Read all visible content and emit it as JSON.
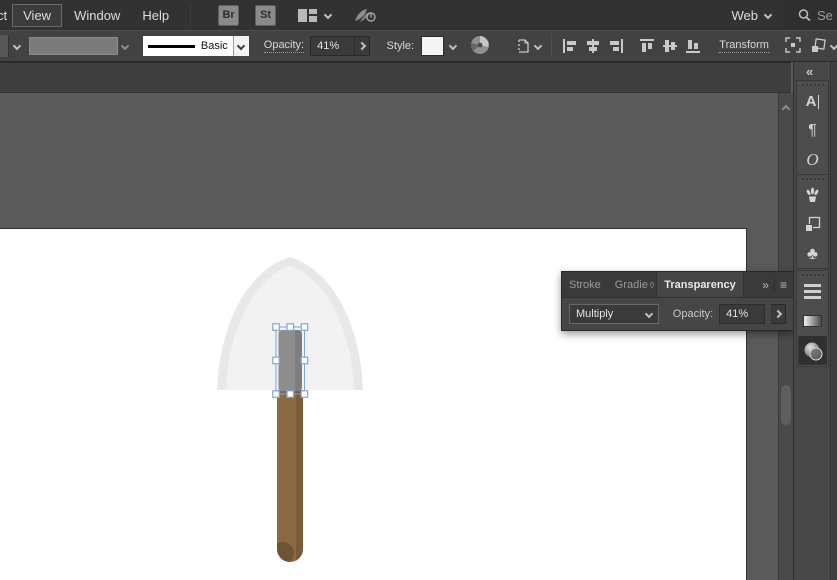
{
  "menubar": {
    "menu_clipped": "ct",
    "menus": [
      "View",
      "Window",
      "Help"
    ],
    "bridge_button": "Br",
    "stock_button": "St",
    "workspace": "Web",
    "search_text": "Se"
  },
  "controlbar": {
    "brush_definition": "Basic",
    "opacity_label": "Opacity:",
    "opacity_value": "41%",
    "style_label": "Style:",
    "transform_link": "Transform"
  },
  "transparency_panel": {
    "tabs": [
      "Stroke",
      "Gradie",
      "Transparency"
    ],
    "active_tab": "Transparency",
    "tab_clip_glyph": "◊",
    "more_glyph": "»",
    "menu_glyph": "≡",
    "blend_mode": "Multiply",
    "opacity_label": "Opacity:",
    "opacity_value": "41%"
  },
  "sidebar": {
    "collapse_glyph": "«",
    "character_glyph": "A",
    "paragraph_glyph": "¶",
    "opentype_glyph": "O",
    "symbols_glyph": "♣",
    "icon_names": [
      "character",
      "paragraph",
      "opentype",
      "brushes",
      "artboards",
      "symbols",
      "stroke",
      "gradient",
      "transparency"
    ]
  },
  "artwork": {
    "object": "shovel",
    "blade_color": "#e8e8e8",
    "blade_inner_color": "#f2f2f2",
    "grip_color": "#8d8d8d",
    "grip_shade_color": "#7e7e7e",
    "handle_color": "#8a6a42",
    "handle_shade_color": "#795b37",
    "handle_tip_color": "#6f5433",
    "selection_color": "#7ea7dc"
  },
  "colors": {
    "menubar_bg": "#323232",
    "controlbar_bg": "#424242",
    "pasteboard": "#5b5b5b",
    "document_band_bg": "#3e3e3e",
    "panel_bg": "#464646",
    "sidebar_bg": "#474747",
    "artboard": "#ffffff"
  }
}
